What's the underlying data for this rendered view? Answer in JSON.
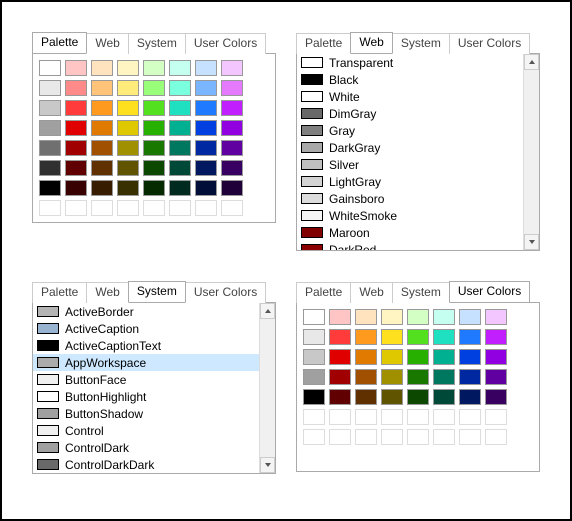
{
  "tabs": {
    "palette": "Palette",
    "web": "Web",
    "system": "System",
    "user": "User Colors"
  },
  "palette_swatches": [
    "#ffffff",
    "#ffc5c5",
    "#ffe3bf",
    "#fff5c2",
    "#d4ffc4",
    "#c4fff0",
    "#c6e0ff",
    "#f3c6ff",
    "#e8e8e8",
    "#ff8a8a",
    "#ffc47a",
    "#ffec7a",
    "#99ff7a",
    "#7affdf",
    "#7ab6ff",
    "#e67aff",
    "#c8c8c8",
    "#ff3b3b",
    "#ff9a1f",
    "#ffe01f",
    "#53e01f",
    "#1fe0c0",
    "#1f7aff",
    "#c21fff",
    "#a0a0a0",
    "#e00000",
    "#e07a00",
    "#e0c800",
    "#28b000",
    "#00b090",
    "#0040e0",
    "#9000e0",
    "#707070",
    "#a00000",
    "#a05000",
    "#a09000",
    "#187800",
    "#007860",
    "#0028a0",
    "#6000a0",
    "#303030",
    "#600000",
    "#603000",
    "#605400",
    "#0c4800",
    "#004838",
    "#001860",
    "#380060",
    "#000000",
    "#380000",
    "#381c00",
    "#383000",
    "#062a00",
    "#002a20",
    "#000e38",
    "#200038"
  ],
  "palette_empty_rows": 1,
  "web_colors": [
    {
      "name": "Transparent",
      "hex": "#ffffff"
    },
    {
      "name": "Black",
      "hex": "#000000"
    },
    {
      "name": "White",
      "hex": "#ffffff"
    },
    {
      "name": "DimGray",
      "hex": "#696969"
    },
    {
      "name": "Gray",
      "hex": "#808080"
    },
    {
      "name": "DarkGray",
      "hex": "#a9a9a9"
    },
    {
      "name": "Silver",
      "hex": "#c0c0c0"
    },
    {
      "name": "LightGray",
      "hex": "#d3d3d3"
    },
    {
      "name": "Gainsboro",
      "hex": "#dcdcdc"
    },
    {
      "name": "WhiteSmoke",
      "hex": "#f5f5f5"
    },
    {
      "name": "Maroon",
      "hex": "#800000"
    },
    {
      "name": "DarkRed",
      "hex": "#8b0000"
    }
  ],
  "system_colors": [
    {
      "name": "ActiveBorder",
      "hex": "#b4b4b4"
    },
    {
      "name": "ActiveCaption",
      "hex": "#99b4d1"
    },
    {
      "name": "ActiveCaptionText",
      "hex": "#000000"
    },
    {
      "name": "AppWorkspace",
      "hex": "#ababab",
      "selected": true
    },
    {
      "name": "ButtonFace",
      "hex": "#f0f0f0"
    },
    {
      "name": "ButtonHighlight",
      "hex": "#ffffff"
    },
    {
      "name": "ButtonShadow",
      "hex": "#a0a0a0"
    },
    {
      "name": "Control",
      "hex": "#f0f0f0"
    },
    {
      "name": "ControlDark",
      "hex": "#a0a0a0"
    },
    {
      "name": "ControlDarkDark",
      "hex": "#696969"
    }
  ],
  "user_swatches": [
    "#ffffff",
    "#ffc5c5",
    "#ffe3bf",
    "#fff5c2",
    "#d4ffc4",
    "#c4fff0",
    "#c6e0ff",
    "#f3c6ff",
    "#e8e8e8",
    "#ff3b3b",
    "#ff9a1f",
    "#ffe01f",
    "#53e01f",
    "#1fe0c0",
    "#1f7aff",
    "#c21fff",
    "#c8c8c8",
    "#e00000",
    "#e07a00",
    "#e0c800",
    "#28b000",
    "#00b090",
    "#0040e0",
    "#9000e0",
    "#a0a0a0",
    "#a00000",
    "#a05000",
    "#a09000",
    "#187800",
    "#007860",
    "#0028a0",
    "#6000a0",
    "#000000",
    "#600000",
    "#603000",
    "#605400",
    "#0c4800",
    "#004838",
    "#001860",
    "#380060"
  ],
  "user_empty_rows": 2
}
